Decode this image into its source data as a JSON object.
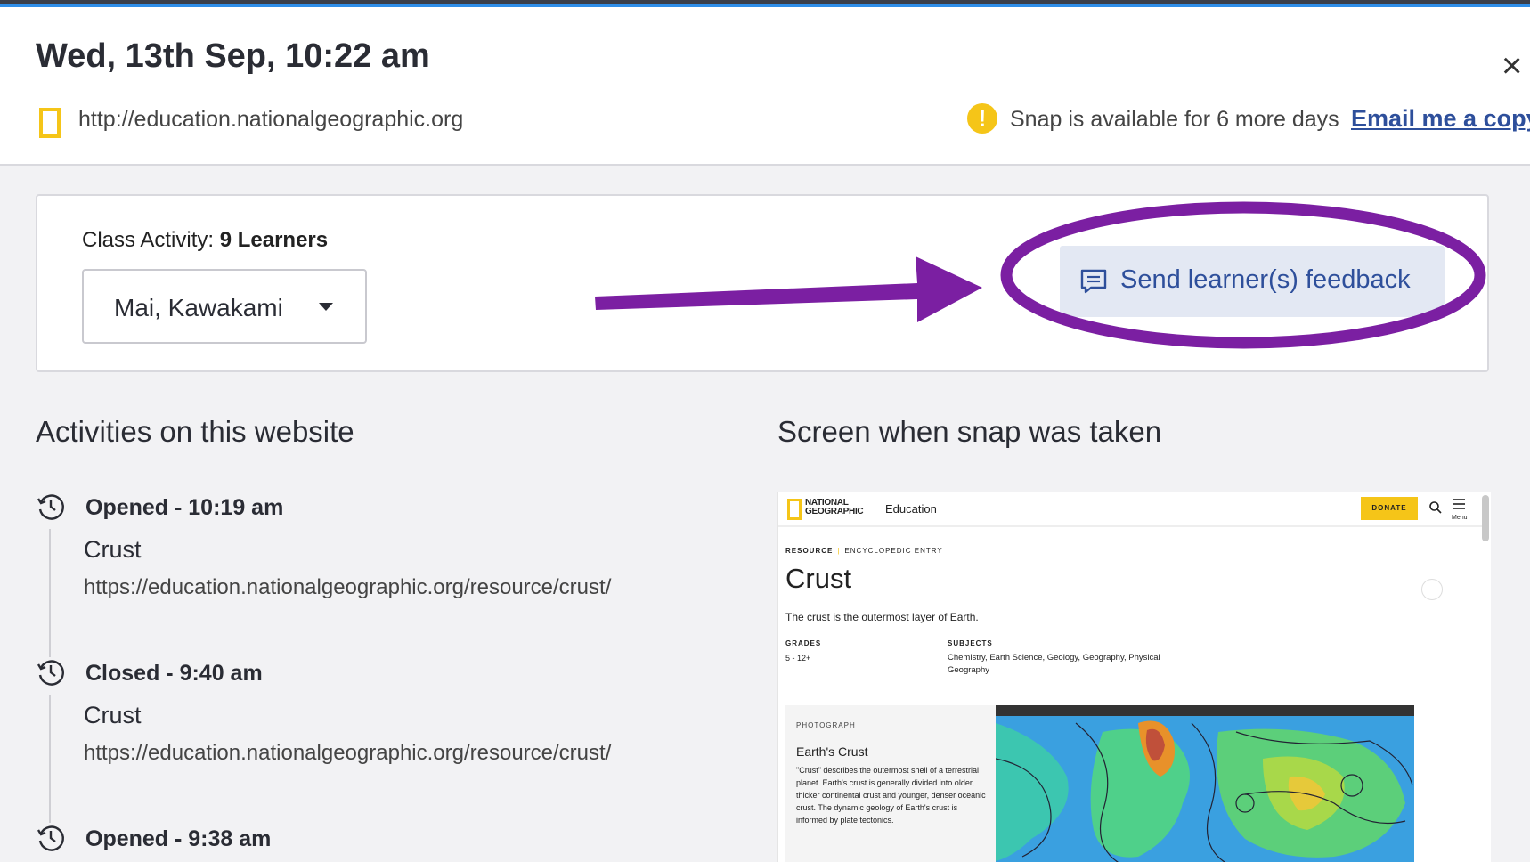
{
  "header": {
    "title": "Wed, 13th Sep, 10:22 am",
    "url": "http://education.nationalgeographic.org",
    "snap_notice": "Snap is available for 6 more days",
    "email_link": "Email me a copy",
    "close_icon": "close-icon",
    "warning_icon": "!"
  },
  "class_activity": {
    "label": "Class Activity:",
    "count": "9 Learners",
    "selected_learner": "Mai, Kawakami",
    "feedback_button": "Send learner(s) feedback"
  },
  "activities": {
    "heading": "Activities on this website",
    "items": [
      {
        "event": "Opened - 10:19 am",
        "title": "Crust",
        "url": "https://education.nationalgeographic.org/resource/crust/"
      },
      {
        "event": "Closed - 9:40 am",
        "title": "Crust",
        "url": "https://education.nationalgeographic.org/resource/crust/"
      },
      {
        "event": "Opened - 9:38 am"
      }
    ]
  },
  "screen": {
    "heading": "Screen when snap was taken",
    "site_logo_line1": "NATIONAL",
    "site_logo_line2": "GEOGRAPHIC",
    "site_section": "Education",
    "donate": "DONATE",
    "menu_label": "Menu",
    "resource_label": "RESOURCE",
    "entry_type": "ENCYCLOPEDIC ENTRY",
    "page_title": "Crust",
    "description": "The crust is the outermost layer of Earth.",
    "grades_label": "GRADES",
    "grades_value": "5 - 12+",
    "subjects_label": "SUBJECTS",
    "subjects_value": "Chemistry, Earth Science, Geology, Geography, Physical Geography",
    "photo_label": "PHOTOGRAPH",
    "photo_title": "Earth's Crust",
    "photo_desc": "\"Crust\" describes the outermost shell of a terrestrial planet. Earth's crust is generally divided into older, thicker continental crust and younger, denser oceanic crust. The dynamic geology of Earth's crust is informed by plate tectonics."
  },
  "colors": {
    "accent_purple": "#7b1fa2",
    "link_blue": "#2e4f9b",
    "ng_yellow": "#f5c518"
  }
}
